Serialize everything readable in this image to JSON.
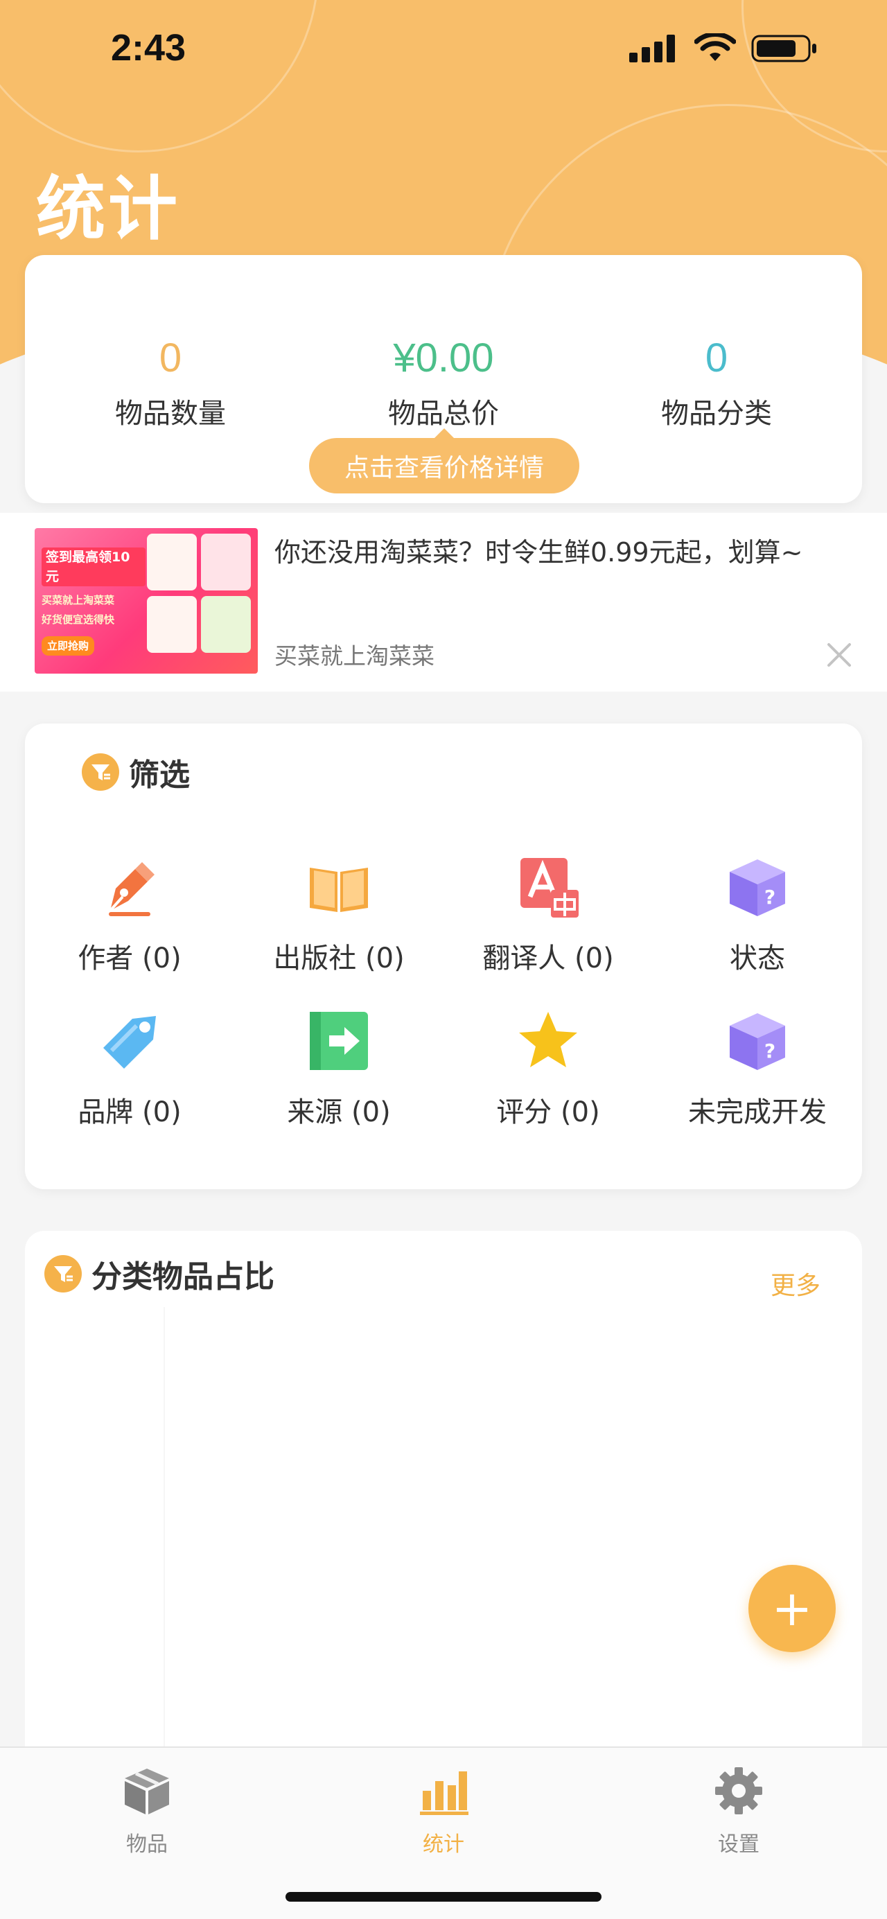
{
  "status_bar": {
    "time": "2:43"
  },
  "header": {
    "title": "统计"
  },
  "stats": {
    "count": {
      "value": "0",
      "label": "物品数量",
      "color": "#f2b760"
    },
    "total_price": {
      "value": "¥0.00",
      "label": "物品总价",
      "color": "#4cbf8a"
    },
    "categories": {
      "value": "0",
      "label": "物品分类",
      "color": "#4bbccc"
    },
    "detail_button": "点击查看价格详情"
  },
  "ad": {
    "headline": "你还没用淘菜菜？时令生鲜0.99元起，划算~",
    "subtitle": "买菜就上淘菜菜",
    "image_text": [
      "签到最高领10元",
      "买菜就上淘菜菜",
      "好货便宜选得快",
      "立即抢购"
    ]
  },
  "filter": {
    "title": "筛选",
    "items": [
      {
        "label": "作者 (0)",
        "icon": "pen-icon"
      },
      {
        "label": "出版社 (0)",
        "icon": "book-icon"
      },
      {
        "label": "翻译人 (0)",
        "icon": "translate-icon"
      },
      {
        "label": "状态",
        "icon": "mystery-box-icon"
      },
      {
        "label": "品牌 (0)",
        "icon": "tag-icon"
      },
      {
        "label": "来源 (0)",
        "icon": "source-arrow-icon"
      },
      {
        "label": "评分 (0)",
        "icon": "star-icon"
      },
      {
        "label": "未完成开发",
        "icon": "mystery-box-icon"
      }
    ]
  },
  "category_chart": {
    "title": "分类物品占比",
    "more_label": "更多"
  },
  "fab": {
    "label": "+"
  },
  "tabs": [
    {
      "label": "物品",
      "icon": "box-icon",
      "active": false
    },
    {
      "label": "统计",
      "icon": "bar-chart-icon",
      "active": true
    },
    {
      "label": "设置",
      "icon": "gear-icon",
      "active": false
    }
  ],
  "colors": {
    "accent": "#f8be6a",
    "active_tab": "#f2b146",
    "inactive_tab": "#8a8a8a"
  }
}
